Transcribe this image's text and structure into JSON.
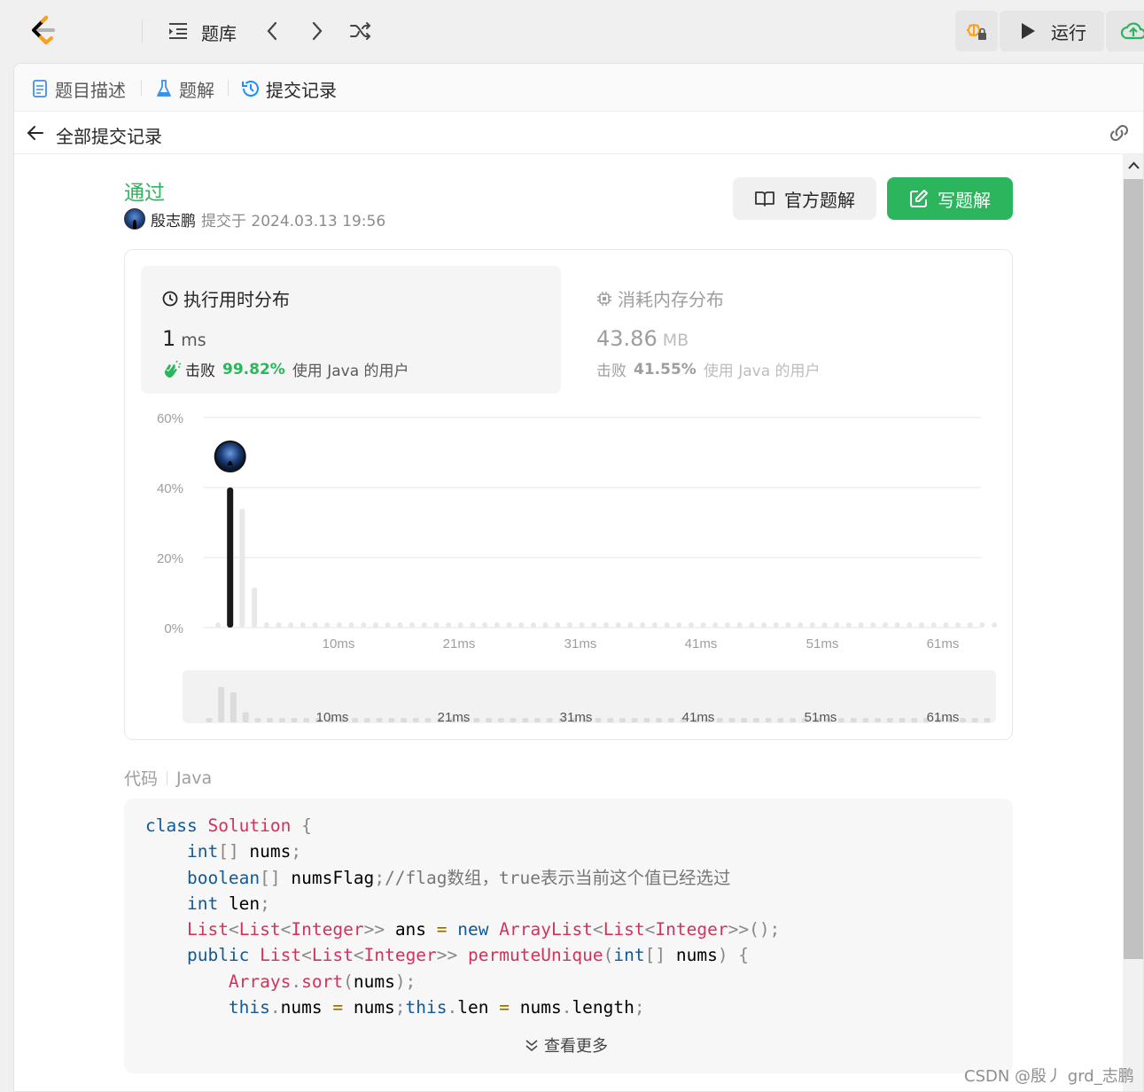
{
  "topbar": {
    "problem_bank_label": "题库",
    "run_label": "运行"
  },
  "tabs": [
    {
      "label": "题目描述",
      "icon": "document-icon"
    },
    {
      "label": "题解",
      "icon": "flask-icon"
    },
    {
      "label": "提交记录",
      "icon": "history-icon",
      "active": true
    }
  ],
  "back_title": "全部提交记录",
  "submission": {
    "status": "通过",
    "user": "殷志鹏",
    "submitted_text": "提交于 2024.03.13 19:56"
  },
  "buttons": {
    "official_solution": "官方题解",
    "write_solution": "写题解"
  },
  "runtime": {
    "title": "执行用时分布",
    "value": "1",
    "unit": "ms",
    "beat_label": "击败",
    "beat_pct": "99.82%",
    "beat_suffix": "使用 Java 的用户"
  },
  "memory": {
    "title": "消耗内存分布",
    "value": "43.86",
    "unit": "MB",
    "beat_label": "击败",
    "beat_pct": "41.55%",
    "beat_suffix": "使用 Java 的用户"
  },
  "chart_data": {
    "type": "bar",
    "y_ticks": [
      "60%",
      "40%",
      "20%",
      "0%"
    ],
    "ylim": [
      0,
      60
    ],
    "x_tick_labels": [
      "10ms",
      "21ms",
      "31ms",
      "41ms",
      "51ms",
      "61ms"
    ],
    "highlight_index": 1,
    "values": [
      1.5,
      40,
      34,
      11.5,
      1.5,
      1.5,
      1.5,
      1.5,
      1.5,
      1.5,
      1.5,
      1.5,
      1.5,
      1.5,
      1.5,
      1.5,
      1.5,
      1.5,
      1.5,
      1.5,
      1.5,
      1.5,
      1.5,
      1.5,
      1.5,
      1.5,
      1.5,
      1.5,
      1.5,
      1.5,
      1.5,
      1.5,
      1.5,
      1.5,
      1.5,
      1.5,
      1.5,
      1.5,
      1.5,
      1.5,
      1.5,
      1.5,
      1.5,
      1.5,
      1.5,
      1.5,
      1.5,
      1.5,
      1.5,
      1.5,
      1.5,
      1.5,
      1.5,
      1.5,
      1.5,
      1.5,
      1.5,
      1.5,
      1.5,
      1.5,
      1.5,
      1.5,
      1.5,
      1.5,
      1.5
    ],
    "grid": true,
    "colors": {
      "highlight": "#1a1a1a",
      "normal": "#e8e8e8",
      "grid": "#e6e6e6"
    }
  },
  "code": {
    "label": "代码",
    "language": "Java",
    "show_more": "查看更多"
  },
  "watermark": "CSDN @殷丿 grd_志鹏",
  "colors": {
    "accent_green": "#2db55d",
    "active_blue": "#1a90ff"
  }
}
